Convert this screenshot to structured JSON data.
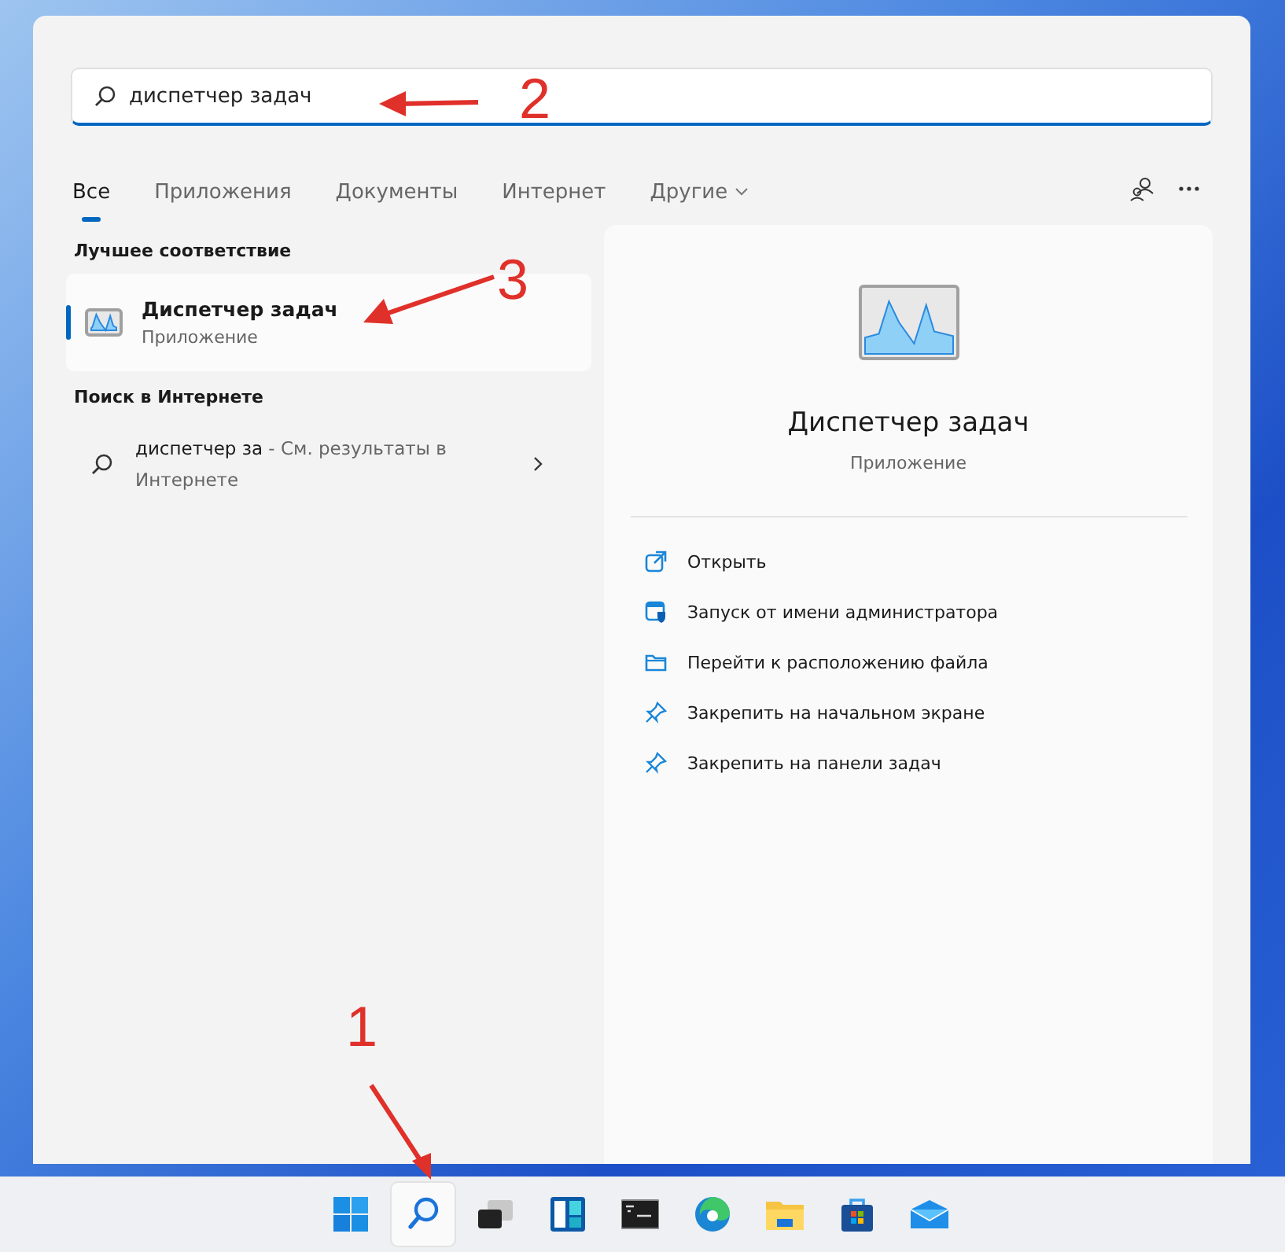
{
  "search": {
    "value": "диспетчер задач"
  },
  "tabs": [
    {
      "label": "Все",
      "selected": true
    },
    {
      "label": "Приложения",
      "selected": false
    },
    {
      "label": "Документы",
      "selected": false
    },
    {
      "label": "Интернет",
      "selected": false
    },
    {
      "label": "Другие",
      "selected": false,
      "dropdown": true
    }
  ],
  "best_match": {
    "heading": "Лучшее соответствие",
    "title": "Диспетчер задач",
    "subtitle": "Приложение",
    "selected": true
  },
  "web_search": {
    "heading": "Поиск в Интернете",
    "query": "диспетчер за",
    "suffix": " - См. результаты в Интернете"
  },
  "details": {
    "title": "Диспетчер задач",
    "subtitle": "Приложение",
    "actions": [
      {
        "kind": "open",
        "label": "Открыть"
      },
      {
        "kind": "admin",
        "label": "Запуск от имени администратора"
      },
      {
        "kind": "folder",
        "label": "Перейти к расположению файла"
      },
      {
        "kind": "pin",
        "label": "Закрепить на начальном экране"
      },
      {
        "kind": "pin",
        "label": "Закрепить на панели задач"
      }
    ]
  },
  "taskbar": [
    {
      "kind": "start",
      "selected": false
    },
    {
      "kind": "search",
      "selected": true
    },
    {
      "kind": "taskview",
      "selected": false
    },
    {
      "kind": "widgets",
      "selected": false
    },
    {
      "kind": "terminal",
      "selected": false
    },
    {
      "kind": "edge",
      "selected": false
    },
    {
      "kind": "explorer",
      "selected": false
    },
    {
      "kind": "store",
      "selected": false
    },
    {
      "kind": "mail",
      "selected": false
    }
  ],
  "annotations": [
    {
      "label": "1"
    },
    {
      "label": "2"
    },
    {
      "label": "3"
    }
  ]
}
